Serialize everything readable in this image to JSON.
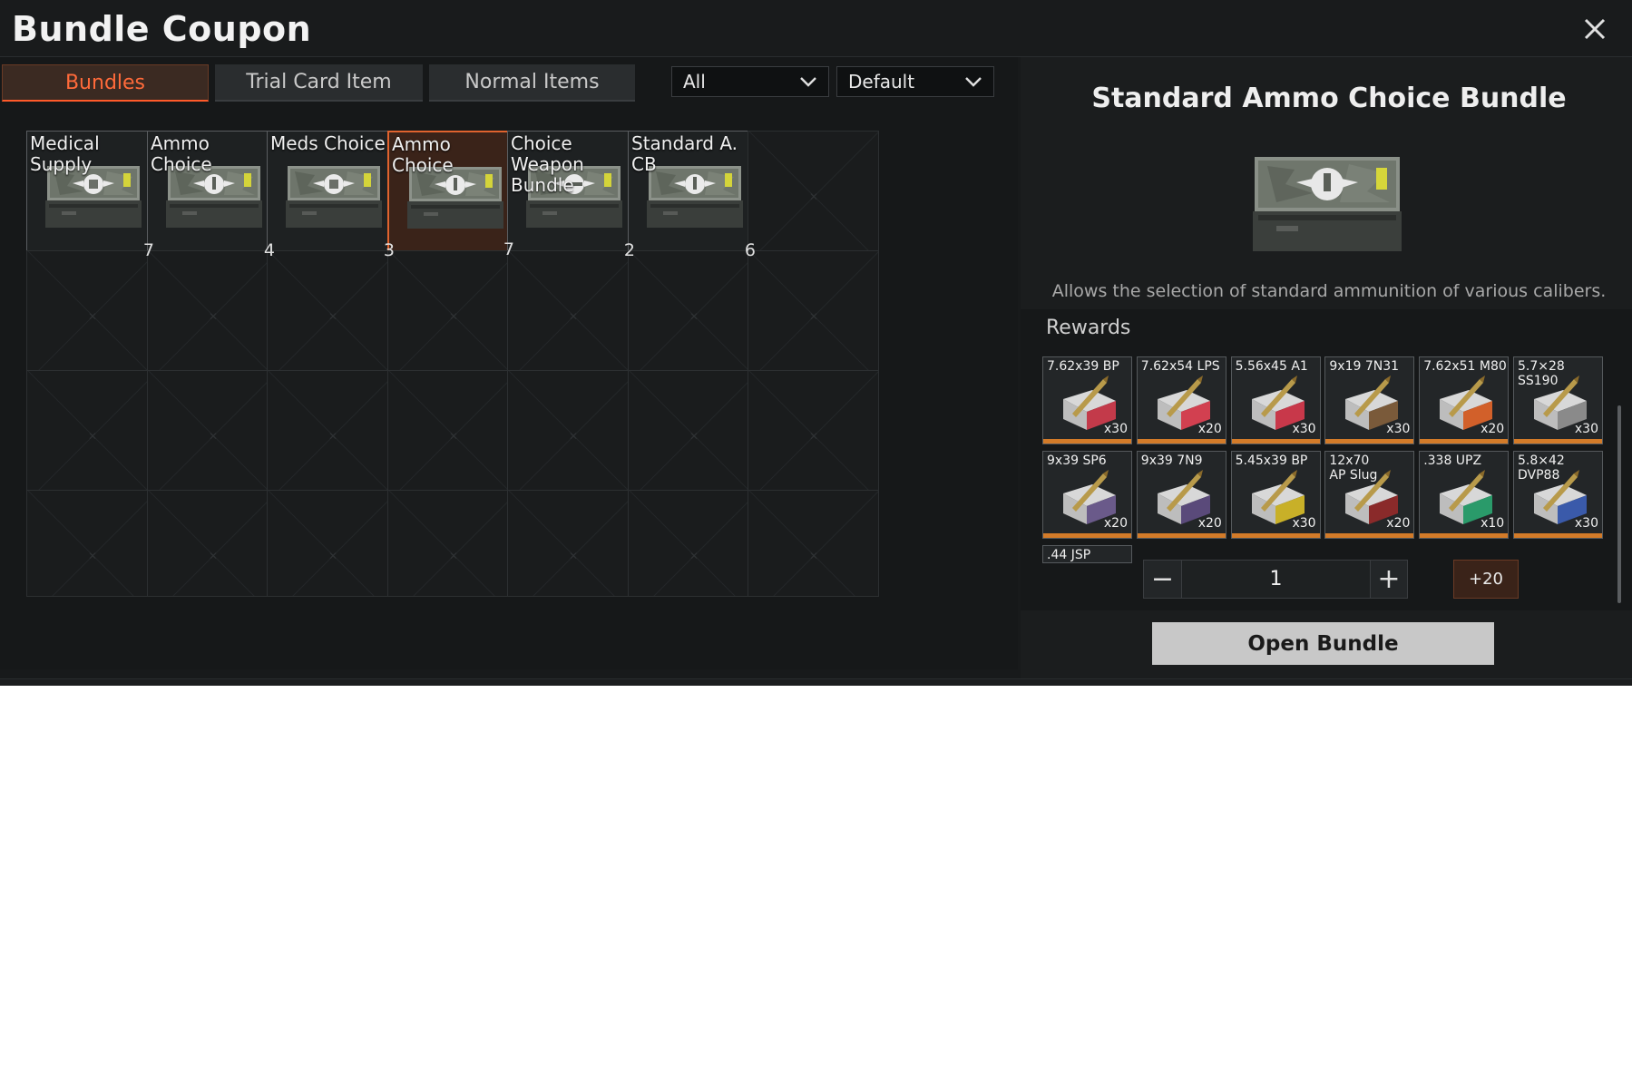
{
  "header": {
    "title": "Bundle Coupon",
    "close_icon": "close-icon"
  },
  "tabs": [
    {
      "label": "Bundles",
      "active": true
    },
    {
      "label": "Trial Card Item",
      "active": false
    },
    {
      "label": "Normal Items",
      "active": false
    }
  ],
  "filters": {
    "category": "All",
    "sort": "Default"
  },
  "bundles": [
    {
      "label": "Medical Supply",
      "count": "7",
      "emblem": "medical"
    },
    {
      "label": "Ammo Choice",
      "count": "4",
      "emblem": "ammo"
    },
    {
      "label": "Meds Choice",
      "count": "3",
      "emblem": "medical"
    },
    {
      "label": "Ammo Choice",
      "count": "7",
      "emblem": "ammo",
      "selected": true
    },
    {
      "label": "Choice Weapon Bundle",
      "count": "2",
      "emblem": "weapon"
    },
    {
      "label": "Standard A. CB",
      "count": "6",
      "emblem": "ammo"
    }
  ],
  "detail": {
    "title": "Standard Ammo Choice Bundle",
    "description": "Allows the selection of standard ammunition of various calibers.",
    "rewards_title": "Rewards",
    "rewards": [
      {
        "name": "7.62x39 BP",
        "qty": "x30",
        "color": "#c33a4a"
      },
      {
        "name": "7.62x54 LPS",
        "qty": "x20",
        "color": "#d24050"
      },
      {
        "name": "5.56x45 A1",
        "qty": "x30",
        "color": "#c8384a"
      },
      {
        "name": "9x19 7N31",
        "qty": "x30",
        "color": "#7a5a3a"
      },
      {
        "name": "7.62x51 M80",
        "qty": "x20",
        "color": "#d2602a"
      },
      {
        "name": "5.7×28 SS190",
        "qty": "x30",
        "color": "#8a8a8a"
      },
      {
        "name": "9x39 SP6",
        "qty": "x20",
        "color": "#6a5a8a"
      },
      {
        "name": "9x39 7N9",
        "qty": "x20",
        "color": "#5a4a7a"
      },
      {
        "name": "5.45x39 BP",
        "qty": "x30",
        "color": "#c8b028"
      },
      {
        "name": "12x70 AP Slug",
        "qty": "x20",
        "color": "#8a2a2a"
      },
      {
        "name": ".338 UPZ",
        "qty": "x10",
        "color": "#2a9a6a"
      },
      {
        "name": "5.8×42 DVP88",
        "qty": "x30",
        "color": "#3a5aaa"
      },
      {
        "name": ".44 JSP",
        "qty": "",
        "color": "#6a6a6a"
      }
    ],
    "quantity": "1",
    "minus_label": "−",
    "plus_label": "+",
    "plus20_label": "+20",
    "open_label": "Open Bundle"
  },
  "colors": {
    "accent": "#e0632e",
    "accent_text": "#ff6a3a",
    "progress": "#d37b29"
  }
}
